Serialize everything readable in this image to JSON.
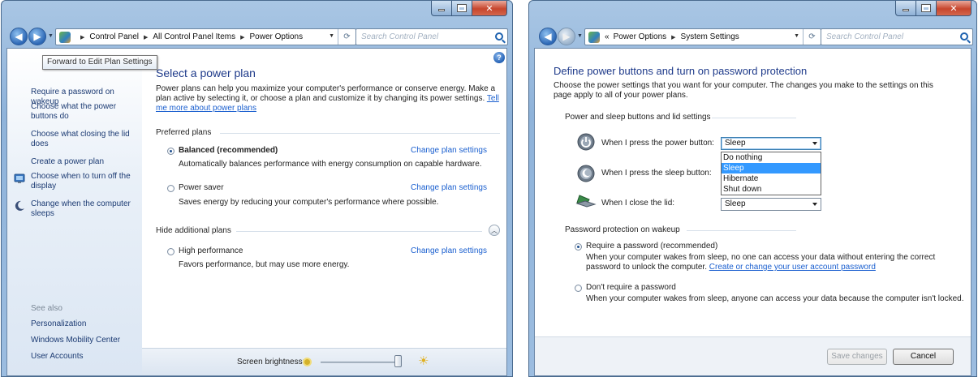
{
  "window1": {
    "address": {
      "crumbs": [
        "Control Panel",
        "All Control Panel Items",
        "Power Options"
      ]
    },
    "search": {
      "placeholder": "Search Control Panel"
    },
    "tooltip": "Forward to Edit Plan Settings",
    "left_pane": {
      "links": [
        "Require a password on wakeup",
        "Choose what the power buttons do",
        "Choose what closing the lid does",
        "Create a power plan",
        "Choose when to turn off the display",
        "Change when the computer sleeps"
      ],
      "see_also_label": "See also",
      "see_also_links": [
        "Personalization",
        "Windows Mobility Center",
        "User Accounts"
      ]
    },
    "main": {
      "title": "Select a power plan",
      "intro": "Power plans can help you maximize your computer's performance or conserve energy. Make a plan active by selecting it, or choose a plan and customize it by changing its power settings.",
      "intro_link": "Tell me more about power plans",
      "preferred_label": "Preferred plans",
      "hide_label": "Hide additional plans",
      "change_plan_label": "Change plan settings",
      "plans": [
        {
          "name": "Balanced (recommended)",
          "desc": "Automatically balances performance with energy consumption on capable hardware.",
          "selected": true
        },
        {
          "name": "Power saver",
          "desc": "Saves energy by reducing your computer's performance where possible.",
          "selected": false
        },
        {
          "name": "High performance",
          "desc": "Favors performance, but may use more energy.",
          "selected": false
        }
      ],
      "brightness_label": "Screen brightness:",
      "brightness_level": 1.0
    }
  },
  "window2": {
    "address": {
      "crumbs": [
        "Power Options",
        "System Settings"
      ]
    },
    "search": {
      "placeholder": "Search Control Panel"
    },
    "title": "Define power buttons and turn on password protection",
    "intro": "Choose the power settings that you want for your computer. The changes you make to the settings on this page apply to all of your power plans.",
    "buttons_section": "Power and sleep buttons and lid settings",
    "rows": [
      {
        "label": "When I press the power button:",
        "value": "Sleep"
      },
      {
        "label": "When I press the sleep button:",
        "value": "Sleep"
      },
      {
        "label": "When I close the lid:",
        "value": "Sleep"
      }
    ],
    "dropdown_options": [
      "Do nothing",
      "Sleep",
      "Hibernate",
      "Shut down"
    ],
    "dropdown_selected": "Sleep",
    "password_section": "Password protection on wakeup",
    "pw_options": [
      {
        "label": "Require a password (recommended)",
        "desc": "When your computer wakes from sleep, no one can access your data without entering the correct password to unlock the computer.",
        "link": "Create or change your user account password",
        "selected": true
      },
      {
        "label": "Don't require a password",
        "desc": "When your computer wakes from sleep, anyone can access your data because the computer isn't locked.",
        "selected": false
      }
    ],
    "save_label": "Save changes",
    "cancel_label": "Cancel"
  },
  "colors": {
    "heading": "#1e3a8a",
    "link": "#1a5fcf",
    "selection": "#3399ff"
  },
  "icons": [
    "back-arrow-icon",
    "forward-arrow-icon",
    "control-panel-icon",
    "refresh-icon",
    "search-icon",
    "help-icon",
    "shield-icon",
    "moon-icon",
    "power-button-icon",
    "sleep-button-icon",
    "laptop-lid-icon",
    "sun-icon"
  ]
}
